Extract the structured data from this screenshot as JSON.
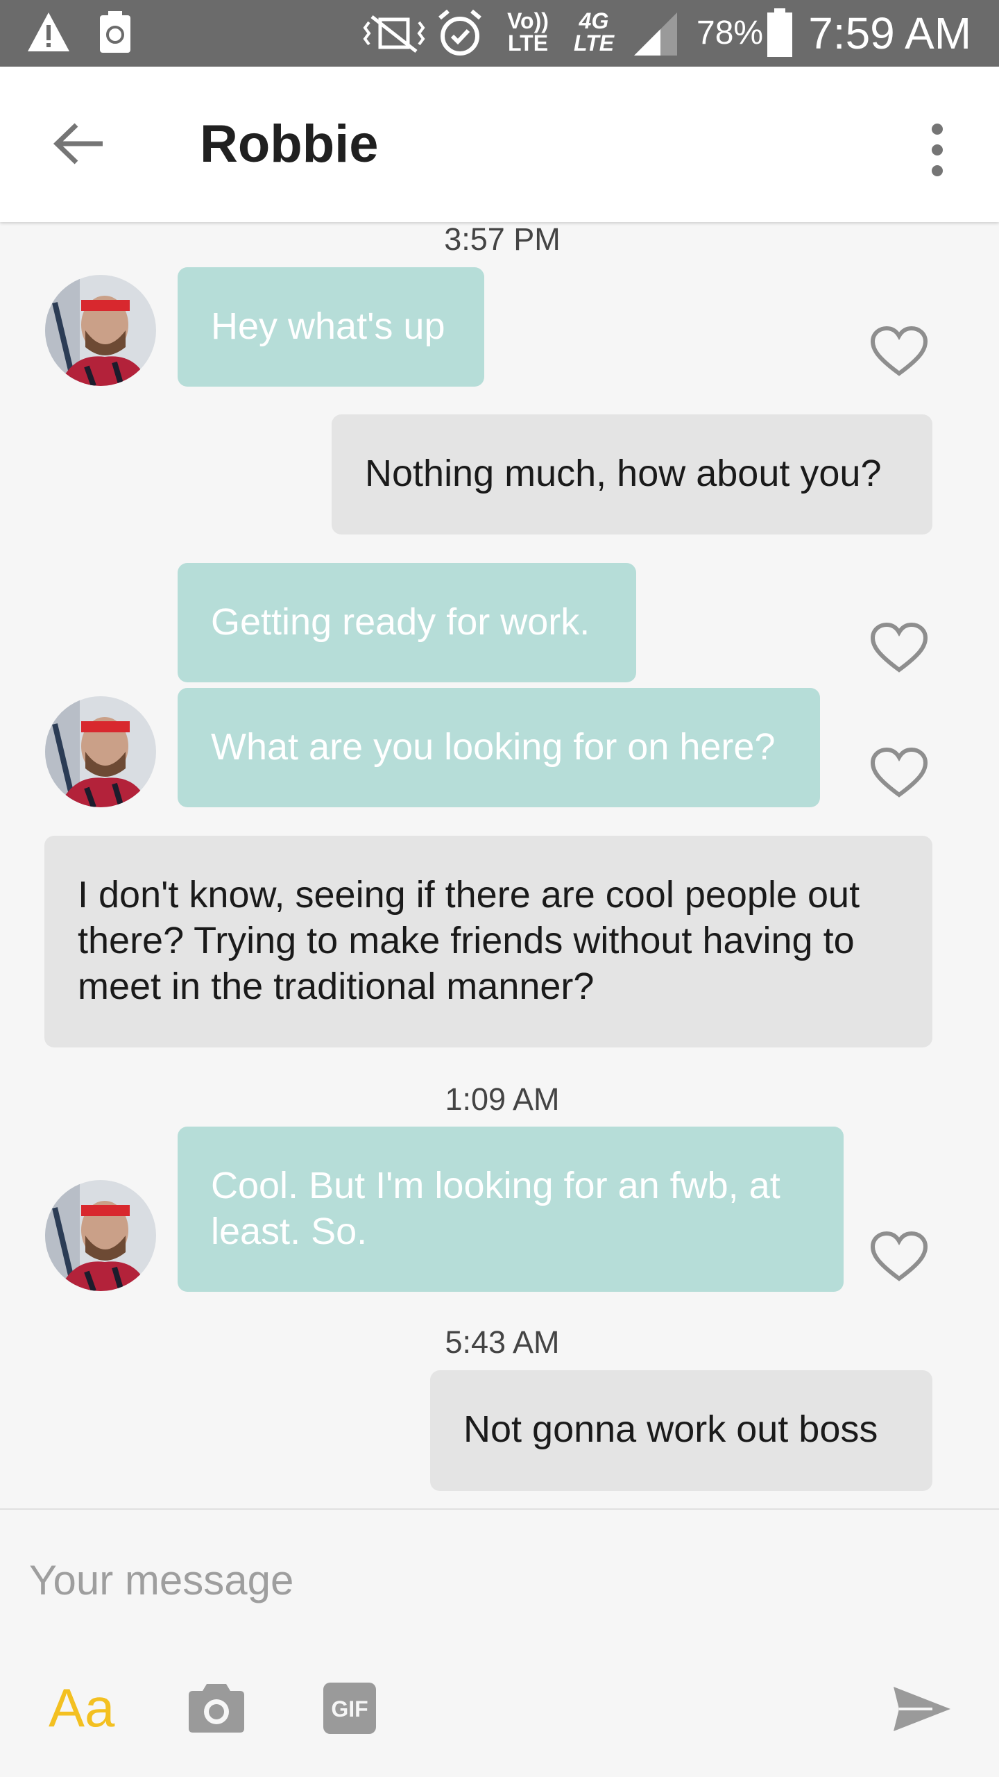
{
  "status_bar": {
    "volte": "Vo)) LTE",
    "network": "4G LTE",
    "battery_percent": "78%",
    "time": "7:59 AM"
  },
  "header": {
    "title": "Robbie",
    "back_icon": "arrow-left-icon",
    "menu_icon": "more-vertical-icon"
  },
  "conversation": {
    "timestamps": [
      "3:57 PM",
      "1:09 AM",
      "5:43 AM"
    ],
    "messages": [
      {
        "from": "them",
        "text": "Hey what's up"
      },
      {
        "from": "me",
        "text": "Nothing much, how about you?"
      },
      {
        "from": "them",
        "text": "Getting ready for work."
      },
      {
        "from": "them",
        "text": "What are you looking for on here?"
      },
      {
        "from": "me",
        "text": "I don't know, seeing if there are cool people out there? Trying to make friends without having to meet in the traditional manner?"
      },
      {
        "from": "them",
        "text": "Cool. But I'm looking for an fwb, at least. So."
      },
      {
        "from": "me",
        "text": "Not gonna work out boss"
      }
    ]
  },
  "composer": {
    "placeholder": "Your message",
    "format_label": "Aa",
    "gif_label": "GIF",
    "camera_icon": "camera-icon",
    "send_icon": "send-icon"
  },
  "colors": {
    "incoming_bubble": "#b6ddd8",
    "outgoing_bubble": "#e4e4e4",
    "accent": "#f3c021",
    "status_bar": "#6b6b6b"
  }
}
